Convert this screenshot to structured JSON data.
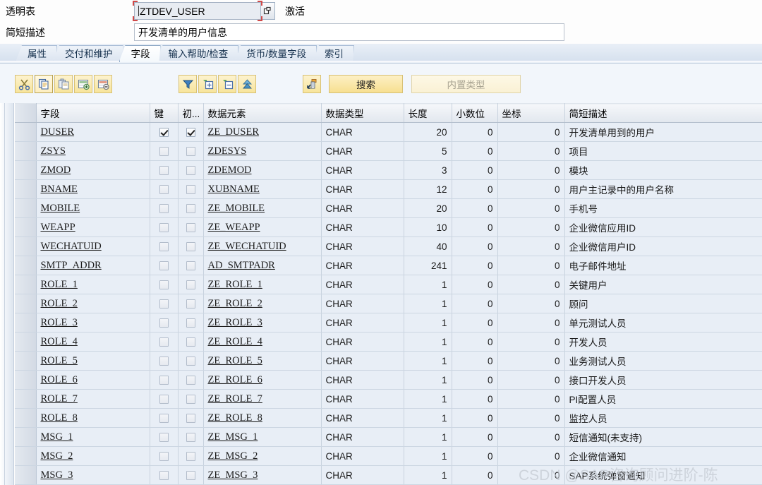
{
  "header": {
    "table_type_label": "透明表",
    "table_name": "ZTDEV_USER",
    "status": "激活",
    "short_desc_label": "简短描述",
    "short_desc_value": "开发清单的用户信息"
  },
  "tabs": [
    {
      "label": "属性",
      "active": false
    },
    {
      "label": "交付和维护",
      "active": false
    },
    {
      "label": "字段",
      "active": true
    },
    {
      "label": "输入帮助/检查",
      "active": false
    },
    {
      "label": "货币/数量字段",
      "active": false
    },
    {
      "label": "索引",
      "active": false
    }
  ],
  "toolbar": {
    "icons_group1": [
      "cut-icon",
      "copy-icon",
      "paste-icon",
      "insert-row-icon",
      "delete-row-icon"
    ],
    "icons_group2": [
      "filter-icon",
      "expand-include-icon",
      "collapse-include-icon",
      "sort-up-icon"
    ],
    "icons_group3": [
      "append-structure-icon"
    ],
    "search_label": "搜索",
    "builtin_type_label": "内置类型",
    "builtin_type_disabled": true
  },
  "grid": {
    "columns": [
      {
        "key": "field",
        "label": "字段"
      },
      {
        "key": "key",
        "label": "键"
      },
      {
        "key": "init",
        "label": "初..."
      },
      {
        "key": "dataelement",
        "label": "数据元素"
      },
      {
        "key": "datatype",
        "label": "数据类型"
      },
      {
        "key": "length",
        "label": "长度"
      },
      {
        "key": "decimals",
        "label": "小数位"
      },
      {
        "key": "coord",
        "label": "坐标"
      },
      {
        "key": "desc",
        "label": "简短描述"
      }
    ],
    "rows": [
      {
        "field": "DUSER",
        "key": true,
        "init": true,
        "dataelement": "ZE_DUSER",
        "datatype": "CHAR",
        "length": "20",
        "decimals": "0",
        "coord": "0",
        "desc": "开发清单用到的用户"
      },
      {
        "field": "ZSYS",
        "key": false,
        "init": false,
        "dataelement": "ZDESYS",
        "datatype": "CHAR",
        "length": "5",
        "decimals": "0",
        "coord": "0",
        "desc": "项目"
      },
      {
        "field": "ZMOD",
        "key": false,
        "init": false,
        "dataelement": "ZDEMOD",
        "datatype": "CHAR",
        "length": "3",
        "decimals": "0",
        "coord": "0",
        "desc": "模块"
      },
      {
        "field": "BNAME",
        "key": false,
        "init": false,
        "dataelement": "XUBNAME",
        "datatype": "CHAR",
        "length": "12",
        "decimals": "0",
        "coord": "0",
        "desc": "用户主记录中的用户名称"
      },
      {
        "field": "MOBILE",
        "key": false,
        "init": false,
        "dataelement": "ZE_MOBILE",
        "datatype": "CHAR",
        "length": "20",
        "decimals": "0",
        "coord": "0",
        "desc": "手机号"
      },
      {
        "field": "WEAPP",
        "key": false,
        "init": false,
        "dataelement": "ZE_WEAPP",
        "datatype": "CHAR",
        "length": "10",
        "decimals": "0",
        "coord": "0",
        "desc": "企业微信应用ID"
      },
      {
        "field": "WECHATUID",
        "key": false,
        "init": false,
        "dataelement": "ZE_WECHATUID",
        "datatype": "CHAR",
        "length": "40",
        "decimals": "0",
        "coord": "0",
        "desc": "企业微信用户ID"
      },
      {
        "field": "SMTP_ADDR",
        "key": false,
        "init": false,
        "dataelement": "AD_SMTPADR",
        "datatype": "CHAR",
        "length": "241",
        "decimals": "0",
        "coord": "0",
        "desc": "电子邮件地址"
      },
      {
        "field": "ROLE_1",
        "key": false,
        "init": false,
        "dataelement": "ZE_ROLE_1",
        "datatype": "CHAR",
        "length": "1",
        "decimals": "0",
        "coord": "0",
        "desc": "关键用户"
      },
      {
        "field": "ROLE_2",
        "key": false,
        "init": false,
        "dataelement": "ZE_ROLE_2",
        "datatype": "CHAR",
        "length": "1",
        "decimals": "0",
        "coord": "0",
        "desc": "顾问"
      },
      {
        "field": "ROLE_3",
        "key": false,
        "init": false,
        "dataelement": "ZE_ROLE_3",
        "datatype": "CHAR",
        "length": "1",
        "decimals": "0",
        "coord": "0",
        "desc": "单元测试人员"
      },
      {
        "field": "ROLE_4",
        "key": false,
        "init": false,
        "dataelement": "ZE_ROLE_4",
        "datatype": "CHAR",
        "length": "1",
        "decimals": "0",
        "coord": "0",
        "desc": "开发人员"
      },
      {
        "field": "ROLE_5",
        "key": false,
        "init": false,
        "dataelement": "ZE_ROLE_5",
        "datatype": "CHAR",
        "length": "1",
        "decimals": "0",
        "coord": "0",
        "desc": "业务测试人员"
      },
      {
        "field": "ROLE_6",
        "key": false,
        "init": false,
        "dataelement": "ZE_ROLE_6",
        "datatype": "CHAR",
        "length": "1",
        "decimals": "0",
        "coord": "0",
        "desc": "接口开发人员"
      },
      {
        "field": "ROLE_7",
        "key": false,
        "init": false,
        "dataelement": "ZE_ROLE_7",
        "datatype": "CHAR",
        "length": "1",
        "decimals": "0",
        "coord": "0",
        "desc": "PI配置人员"
      },
      {
        "field": "ROLE_8",
        "key": false,
        "init": false,
        "dataelement": "ZE_ROLE_8",
        "datatype": "CHAR",
        "length": "1",
        "decimals": "0",
        "coord": "0",
        "desc": "监控人员"
      },
      {
        "field": "MSG_1",
        "key": false,
        "init": false,
        "dataelement": "ZE_MSG_1",
        "datatype": "CHAR",
        "length": "1",
        "decimals": "0",
        "coord": "0",
        "desc": "短信通知(未支持)"
      },
      {
        "field": "MSG_2",
        "key": false,
        "init": false,
        "dataelement": "ZE_MSG_2",
        "datatype": "CHAR",
        "length": "1",
        "decimals": "0",
        "coord": "0",
        "desc": "企业微信通知"
      },
      {
        "field": "MSG_3",
        "key": false,
        "init": false,
        "dataelement": "ZE_MSG_3",
        "datatype": "CHAR",
        "length": "1",
        "decimals": "0",
        "coord": "0",
        "desc": "SAP系统弹窗通知"
      }
    ]
  },
  "watermark": "CSDN @SAP咨询顾问进阶-陈"
}
